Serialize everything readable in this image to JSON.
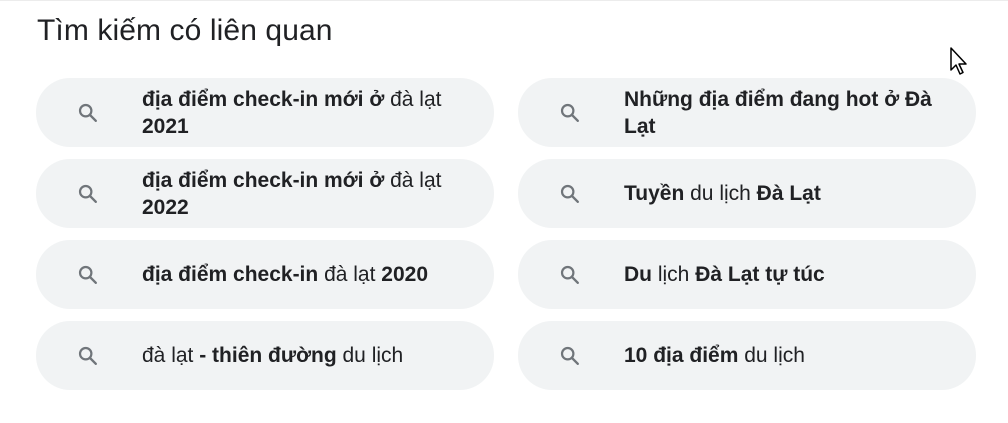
{
  "section": {
    "title": "Tìm kiếm có liên quan"
  },
  "related_searches": [
    {
      "icon": "search-icon",
      "segments": [
        {
          "text": "địa điểm check-in mới ở",
          "bold": true
        },
        {
          "text": " đà lạt ",
          "bold": false
        },
        {
          "text": "2021",
          "bold": true
        }
      ]
    },
    {
      "icon": "search-icon",
      "segments": [
        {
          "text": "Những địa điểm đang hot ở Đà Lạt",
          "bold": true
        }
      ]
    },
    {
      "icon": "search-icon",
      "segments": [
        {
          "text": "địa điểm check-in mới ở",
          "bold": true
        },
        {
          "text": " đà lạt ",
          "bold": false
        },
        {
          "text": "2022",
          "bold": true
        }
      ]
    },
    {
      "icon": "search-icon",
      "segments": [
        {
          "text": "Tuyền",
          "bold": true
        },
        {
          "text": " du lịch ",
          "bold": false
        },
        {
          "text": "Đà Lạt",
          "bold": true
        }
      ]
    },
    {
      "icon": "search-icon",
      "segments": [
        {
          "text": "địa điểm check-in",
          "bold": true
        },
        {
          "text": " đà lạt ",
          "bold": false
        },
        {
          "text": "2020",
          "bold": true
        }
      ]
    },
    {
      "icon": "search-icon",
      "segments": [
        {
          "text": "Du",
          "bold": true
        },
        {
          "text": " lịch ",
          "bold": false
        },
        {
          "text": "Đà Lạt tự túc",
          "bold": true
        }
      ]
    },
    {
      "icon": "search-icon",
      "segments": [
        {
          "text": "đà lạt ",
          "bold": false
        },
        {
          "text": "- thiên đường",
          "bold": true
        },
        {
          "text": " du lịch",
          "bold": false
        }
      ]
    },
    {
      "icon": "search-icon",
      "segments": [
        {
          "text": "10 địa điểm",
          "bold": true
        },
        {
          "text": " du lịch",
          "bold": false
        }
      ]
    }
  ],
  "colors": {
    "chip_background": "#f1f3f4",
    "text": "#202124",
    "icon": "#70757a"
  },
  "cursor": {
    "icon": "mouse-pointer-icon"
  }
}
